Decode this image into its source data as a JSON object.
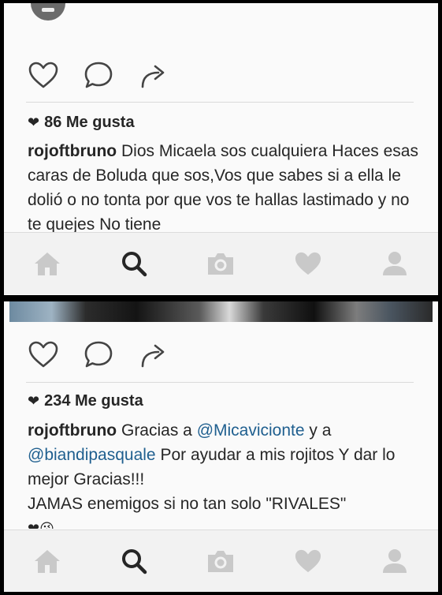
{
  "screens": [
    {
      "likes": "86 Me gusta",
      "caption": {
        "user": "rojoftbruno",
        "text": "Dios Micaela sos cualquiera Haces esas caras de Boluda que sos,Vos que sabes si a ella le dolió o no tonta por que vos te hallas lastimado y no te quejes No tiene"
      }
    },
    {
      "likes": "234 Me gusta",
      "caption": {
        "user": "rojoftbruno",
        "part1": "Gracias a ",
        "mention1": "@Micavicionte",
        "part2": " y a ",
        "mention2": "@biandipasquale",
        "part3": " Por ayudar a mis rojitos Y dar lo mejor Gracias!!!",
        "line2": "JAMAS enemigos si no tan solo \"RIVALES\"",
        "emoji": "❤😘"
      }
    }
  ],
  "icons": {
    "like": "heart-outline-icon",
    "comment": "comment-bubble-icon",
    "share": "share-arrow-icon",
    "tabs": [
      "home-icon",
      "search-icon",
      "camera-icon",
      "activity-heart-icon",
      "profile-icon"
    ]
  },
  "colors": {
    "background": "#fafafa",
    "tab_inactive": "#c9c9c9",
    "tab_active": "#262626",
    "mention": "#1f5f8f",
    "text": "#262626"
  }
}
